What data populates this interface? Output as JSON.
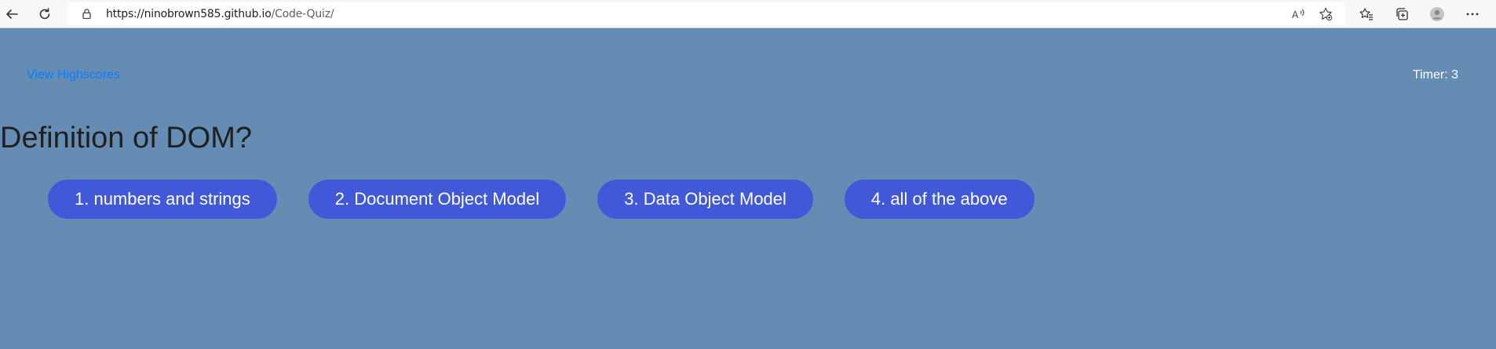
{
  "browser": {
    "url_host": "https://ninobrown585.github.io",
    "url_path": "/Code-Quiz/"
  },
  "header": {
    "highscores_link": "View Highscores",
    "timer": "Timer: 3"
  },
  "quiz": {
    "question": "Definition of DOM?",
    "answers": [
      "1. numbers and strings",
      "2. Document Object Model",
      "3. Data Object Model",
      "4. all of the above"
    ]
  }
}
